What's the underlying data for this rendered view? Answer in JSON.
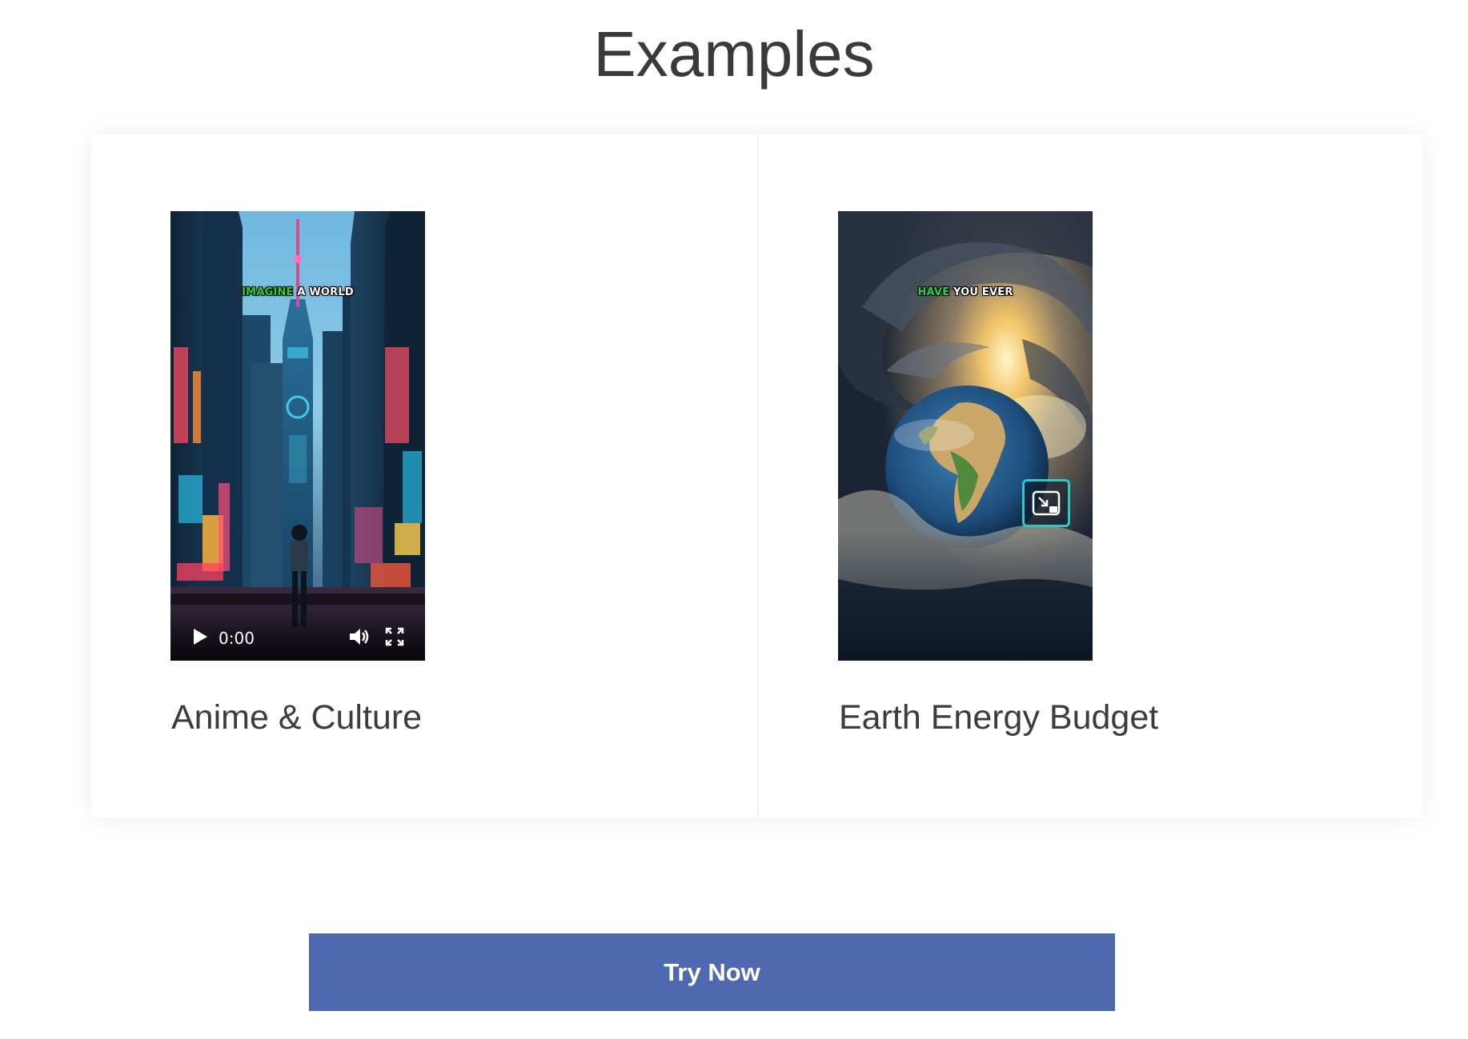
{
  "section": {
    "title": "Examples"
  },
  "cards": [
    {
      "title": "Anime & Culture",
      "caption": {
        "highlight": "IMAGINE",
        "rest": "A WORLD"
      },
      "controls": {
        "time": "0:00",
        "play_icon": "play-icon",
        "volume_icon": "volume-icon",
        "fullscreen_icon": "fullscreen-icon"
      }
    },
    {
      "title": "Earth Energy Budget",
      "caption": {
        "highlight": "HAVE",
        "rest": "YOU EVER"
      },
      "overlay_icon": "picture-in-picture-icon"
    }
  ],
  "cta": {
    "label": "Try Now",
    "color": "#4e69b0"
  },
  "colors": {
    "caption_highlight": "#22d53c",
    "pip_border": "#2ec8c8"
  }
}
